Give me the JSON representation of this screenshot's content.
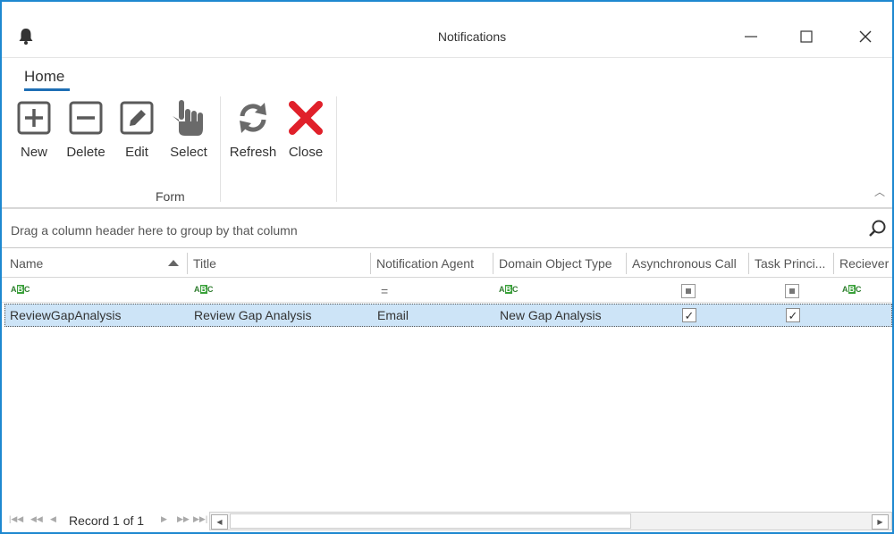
{
  "window": {
    "title": "Notifications",
    "icon": "bell-icon",
    "controls": [
      "minimize-icon",
      "maximize-icon",
      "close-icon"
    ]
  },
  "ribbon": {
    "tab": "Home",
    "buttons": {
      "new": {
        "label": "New",
        "icon": "plus-box-icon"
      },
      "delete": {
        "label": "Delete",
        "icon": "minus-box-icon"
      },
      "edit": {
        "label": "Edit",
        "icon": "pencil-box-icon"
      },
      "select": {
        "label": "Select",
        "icon": "hand-pointer-icon"
      },
      "refresh": {
        "label": "Refresh",
        "icon": "refresh-icon"
      },
      "close": {
        "label": "Close",
        "icon": "red-x-icon"
      }
    },
    "group_label": "Form",
    "colors": {
      "accent": "#1e6fb5",
      "close_red": "#e0202a",
      "icon_gray": "#5a5a5a"
    }
  },
  "grid": {
    "group_panel_text": "Drag a column header here to group by that column",
    "columns": [
      "Name",
      "Title",
      "Notification Agent",
      "Domain Object Type",
      "Asynchronous Call",
      "Task Princi...",
      "Reciever"
    ],
    "sorted_column": "Name",
    "sort_direction": "ascending",
    "rows": [
      {
        "name": "ReviewGapAnalysis",
        "title": "Review Gap Analysis",
        "notification_agent": "Email",
        "domain_object_type": "New Gap Analysis",
        "asynchronous_call": true,
        "task_principal": true,
        "check_mark": "✓"
      }
    ],
    "selected_row_color": "#cde4f7"
  },
  "footer": {
    "record_text": "Record 1 of 1"
  }
}
